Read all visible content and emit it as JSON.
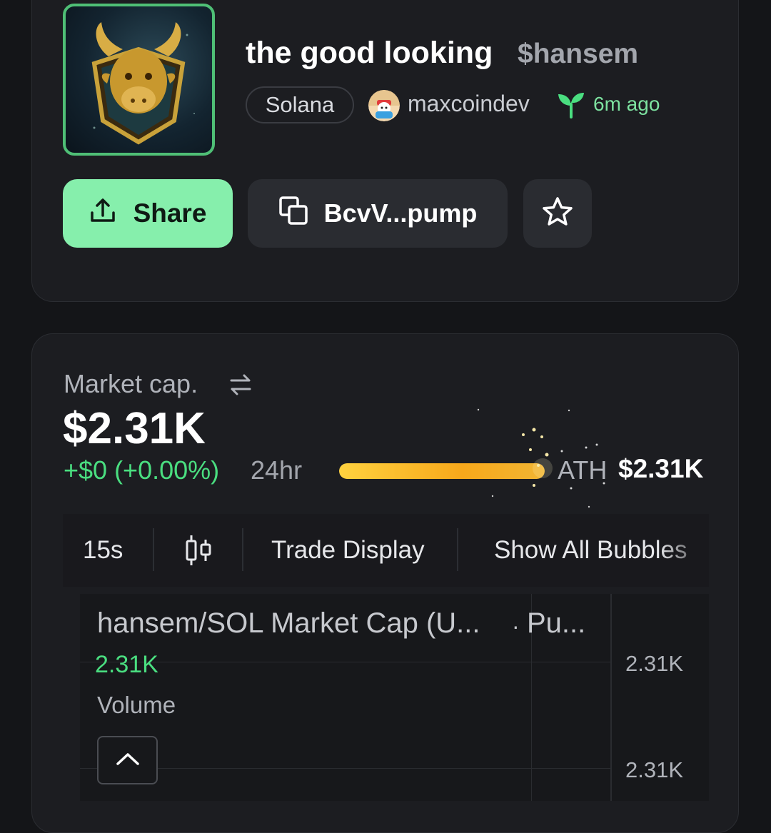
{
  "token": {
    "name": "the good looking",
    "ticker": "$hansem",
    "chain": "Solana",
    "creator": "maxcoindev",
    "age": "6m ago"
  },
  "actions": {
    "share_label": "Share",
    "address_label": "BcvV...pump"
  },
  "market": {
    "label": "Market cap.",
    "value": "$2.31K",
    "change": "+$0 (+0.00%)",
    "period": "24hr",
    "ath_label": "ATH",
    "ath_value": "$2.31K",
    "ath_progress": 1.0
  },
  "toolbar": {
    "interval": "15s",
    "trade_display": "Trade Display",
    "show_bubbles": "Show All Bubbles"
  },
  "chart": {
    "pair_title": "hansem/SOL Market Cap (U...",
    "separator": "·",
    "source": "Pu...",
    "last_value": "2.31K",
    "volume_label": "Volume",
    "y_ticks": [
      "2.31K",
      "2.31K"
    ]
  },
  "colors": {
    "accent_green": "#86efac",
    "positive": "#4ade80",
    "ath_bar": "#f7a81b"
  }
}
